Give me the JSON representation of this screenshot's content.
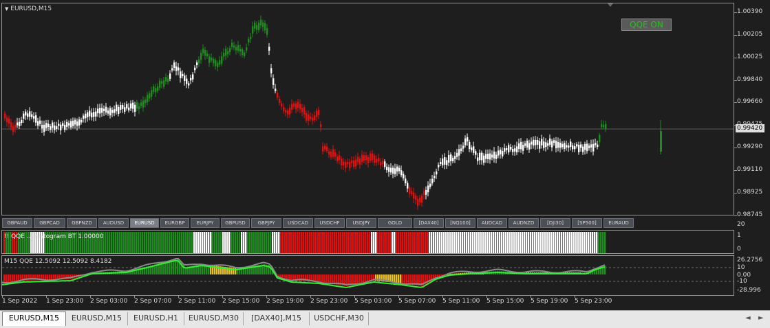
{
  "chart": {
    "title": "EURUSD,M15",
    "current_price": "0.99420",
    "price_axis": [
      "1.00390",
      "1.00205",
      "1.00025",
      "0.99840",
      "0.99660",
      "0.99475",
      "0.99290",
      "0.99110",
      "0.98925",
      "0.98745"
    ],
    "time_axis": [
      "1 Sep 2022",
      "1 Sep 23:00",
      "2 Sep 03:00",
      "2 Sep 07:00",
      "2 Sep 11:00",
      "2 Sep 15:00",
      "2 Sep 19:00",
      "2 Sep 23:00",
      "5 Sep 03:00",
      "5 Sep 07:00",
      "5 Sep 11:00",
      "5 Sep 15:00",
      "5 Sep 19:00",
      "5 Sep 23:00"
    ],
    "colors": {
      "bull": "#1e8c1e",
      "bear": "#e01010",
      "neutral": "#ffffff",
      "background": "#1e1e1e",
      "qqe_line": "#33ee33",
      "qqe_signal": "#8a8a8a",
      "yellow": "#e8c020"
    }
  },
  "qqe_button": {
    "label": "QQE ON"
  },
  "symbol_buttons": [
    "GBPAUD",
    "GBPCAD",
    "GBPNZD",
    "AUDUSD",
    "EURUSD",
    "EURGBP",
    "EURJPY",
    "GBPUSD",
    "GBPJPY",
    "USDCAD",
    "USDCHF",
    "USDJPY",
    "GOLD",
    "[DAX40]",
    "[NQ100]",
    "AUDCAD",
    "AUDNZD",
    "[DJI30]",
    "[SP500]",
    "EURAUD"
  ],
  "active_symbol": "EURUSD",
  "histogram_pane": {
    "label": "!! QQE ... histogram BT 1.00000",
    "axis": [
      "20",
      "1",
      "0"
    ]
  },
  "qqe_pane": {
    "label": "M15 QQE 12.5092 12.5092 8.4182",
    "axis": [
      "26.2756",
      "10",
      "0.00",
      "-10",
      "-28.996"
    ]
  },
  "tabs": [
    "EURUSD,M15",
    "EURUSD,M15",
    "EURUSD,H1",
    "EURUSD,M30",
    "[DAX40],M15",
    "USDCHF,M30"
  ],
  "active_tab": 0,
  "nav": {
    "left": "◄",
    "right": "►"
  }
}
